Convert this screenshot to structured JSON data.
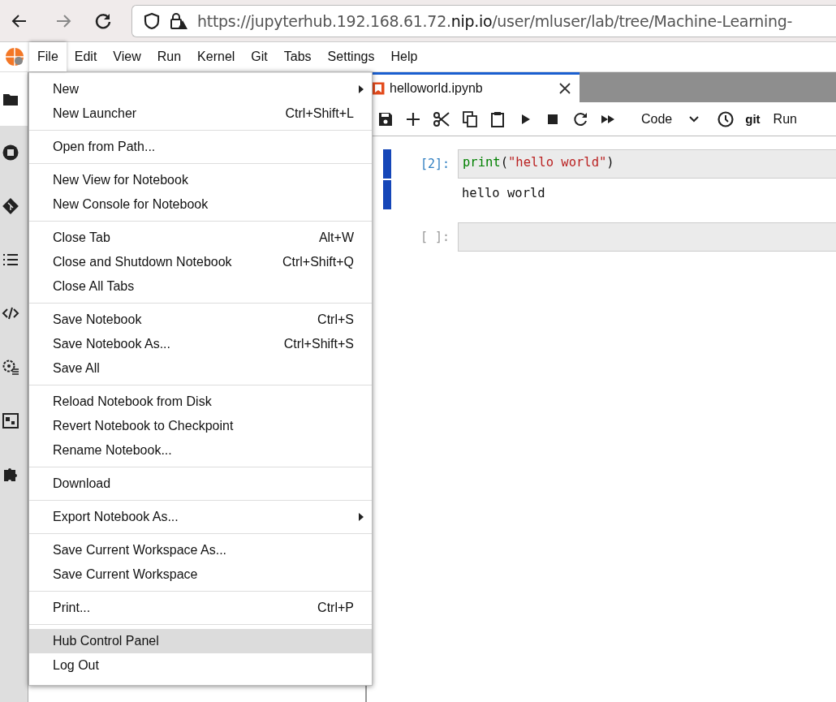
{
  "browser": {
    "url": {
      "host": "https://jupyterhub.192.168.61.72.",
      "domain": "nip.io",
      "path": "/user/mluser/lab/tree/Machine-Learning-"
    }
  },
  "menubar": [
    {
      "label": "File",
      "selected": true
    },
    {
      "label": "Edit",
      "selected": false
    },
    {
      "label": "View",
      "selected": false
    },
    {
      "label": "Run",
      "selected": false
    },
    {
      "label": "Kernel",
      "selected": false
    },
    {
      "label": "Git",
      "selected": false
    },
    {
      "label": "Tabs",
      "selected": false
    },
    {
      "label": "Settings",
      "selected": false
    },
    {
      "label": "Help",
      "selected": false
    }
  ],
  "sidebar": [
    {
      "selected": true
    },
    {
      "selected": false
    },
    {
      "selected": false
    },
    {
      "selected": false
    },
    {
      "selected": false
    },
    {
      "selected": false
    },
    {
      "selected": false
    },
    {
      "selected": false
    }
  ],
  "file_menu": [
    [
      {
        "label": "New",
        "submenu": true,
        "highlighted": false
      },
      {
        "label": "New Launcher",
        "shortcut": "Ctrl+Shift+L",
        "submenu": false,
        "highlighted": false
      }
    ],
    [
      {
        "label": "Open from Path...",
        "submenu": false,
        "highlighted": false
      }
    ],
    [
      {
        "label": "New View for Notebook",
        "submenu": false,
        "highlighted": false
      },
      {
        "label": "New Console for Notebook",
        "submenu": false,
        "highlighted": false
      }
    ],
    [
      {
        "label": "Close Tab",
        "shortcut": "Alt+W",
        "submenu": false,
        "highlighted": false
      },
      {
        "label": "Close and Shutdown Notebook",
        "shortcut": "Ctrl+Shift+Q",
        "submenu": false,
        "highlighted": false
      },
      {
        "label": "Close All Tabs",
        "submenu": false,
        "highlighted": false
      }
    ],
    [
      {
        "label": "Save Notebook",
        "shortcut": "Ctrl+S",
        "submenu": false,
        "highlighted": false
      },
      {
        "label": "Save Notebook As...",
        "shortcut": "Ctrl+Shift+S",
        "submenu": false,
        "highlighted": false
      },
      {
        "label": "Save All",
        "submenu": false,
        "highlighted": false
      }
    ],
    [
      {
        "label": "Reload Notebook from Disk",
        "submenu": false,
        "highlighted": false
      },
      {
        "label": "Revert Notebook to Checkpoint",
        "submenu": false,
        "highlighted": false
      },
      {
        "label": "Rename Notebook...",
        "submenu": false,
        "highlighted": false
      }
    ],
    [
      {
        "label": "Download",
        "submenu": false,
        "highlighted": false
      }
    ],
    [
      {
        "label": "Export Notebook As...",
        "submenu": true,
        "highlighted": false
      }
    ],
    [
      {
        "label": "Save Current Workspace As...",
        "submenu": false,
        "highlighted": false
      },
      {
        "label": "Save Current Workspace",
        "submenu": false,
        "highlighted": false
      }
    ],
    [
      {
        "label": "Print...",
        "shortcut": "Ctrl+P",
        "submenu": false,
        "highlighted": false
      }
    ],
    [
      {
        "label": "Hub Control Panel",
        "submenu": false,
        "highlighted": true
      },
      {
        "label": "Log Out",
        "submenu": false,
        "highlighted": false
      }
    ]
  ],
  "notebook": {
    "tab": {
      "label": "helloworld.ipynb",
      "selected": true
    },
    "toolbar": {
      "cell_type": "Code",
      "git": "git",
      "run": "Run"
    },
    "cells": [
      {
        "prompt": "[2]:",
        "active": true,
        "code": [
          {
            "kind": "builtin",
            "text": "print"
          },
          {
            "kind": "punct",
            "text": "("
          },
          {
            "kind": "string",
            "text": "\"hello world\""
          },
          {
            "kind": "punct",
            "text": ")"
          }
        ],
        "output": "hello world"
      },
      {
        "prompt": "[ ]:",
        "active": false
      }
    ]
  }
}
